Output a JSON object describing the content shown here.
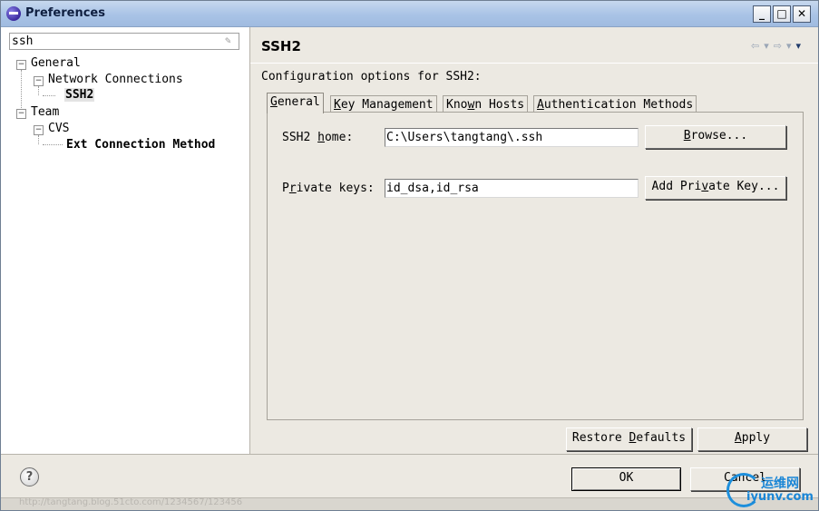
{
  "window": {
    "title": "Preferences",
    "controls": {
      "minimize": "_",
      "maximize": "□",
      "close": "✕"
    }
  },
  "filter": {
    "value": "ssh",
    "placeholder": ""
  },
  "tree": {
    "general": "General",
    "network_connections": "Network Connections",
    "ssh2": "SSH2",
    "team": "Team",
    "cvs": "CVS",
    "ext_connection_method": "Ext Connection Method"
  },
  "page": {
    "title": "SSH2",
    "description": "Configuration options for SSH2:",
    "nav": {
      "back": "⇦",
      "back_menu": "▾",
      "forward": "⇨",
      "forward_menu": "▾",
      "view_menu": "▾"
    }
  },
  "tabs": [
    {
      "label_pre": "",
      "label_u": "G",
      "label_post": "eneral",
      "active": true
    },
    {
      "label_pre": "",
      "label_u": "K",
      "label_post": "ey Management",
      "active": false
    },
    {
      "label_pre": "Kno",
      "label_u": "w",
      "label_post": "n Hosts",
      "active": false
    },
    {
      "label_pre": "",
      "label_u": "A",
      "label_post": "uthentication Methods",
      "active": false
    }
  ],
  "general_tab": {
    "ssh2_home": {
      "label_pre": "SSH2 ",
      "label_u": "h",
      "label_post": "ome:",
      "value": "C:\\Users\\tangtang\\.ssh",
      "button_pre": "",
      "button_u": "B",
      "button_post": "rowse..."
    },
    "private_keys": {
      "label_pre": "P",
      "label_u": "r",
      "label_post": "ivate keys:",
      "value": "id_dsa,id_rsa",
      "button_pre": "Add Pri",
      "button_u": "v",
      "button_post": "ate Key..."
    }
  },
  "actions": {
    "restore_pre": "Restore ",
    "restore_u": "D",
    "restore_post": "efaults",
    "apply_pre": "",
    "apply_u": "A",
    "apply_post": "pply",
    "ok": "OK",
    "cancel": "Cancel"
  },
  "help": {
    "icon": "?"
  },
  "status": {
    "text": "http://tangtang.blog.51cto.com/1234567/123456"
  },
  "watermark": {
    "cn": "运维网",
    "url": "iyunv.com"
  }
}
